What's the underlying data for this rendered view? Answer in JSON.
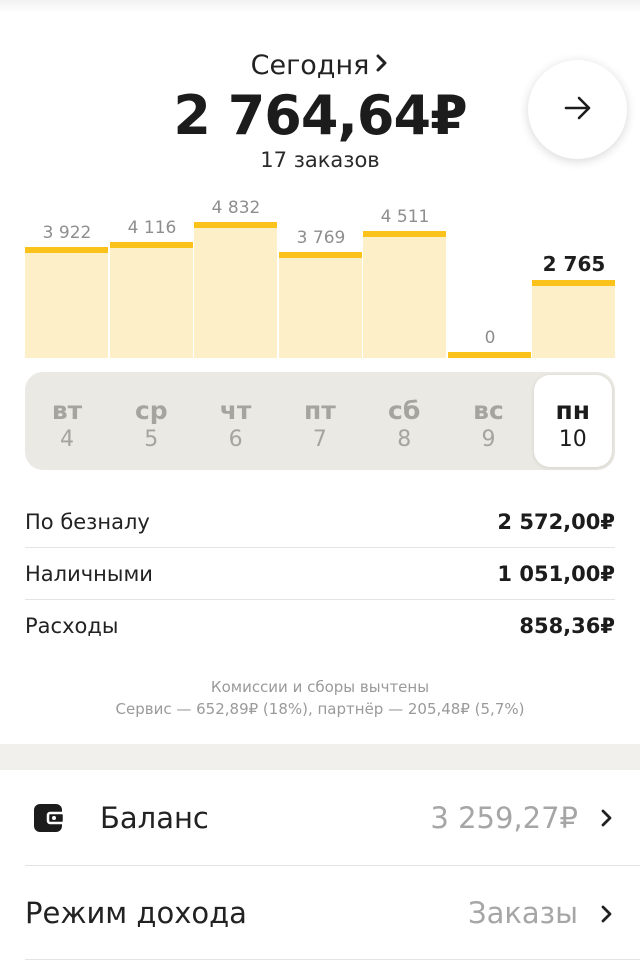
{
  "summary": {
    "period_label": "Сегодня",
    "total": "2 764,64₽",
    "orders": "17 заказов"
  },
  "chart_data": {
    "type": "bar",
    "categories": [
      "вт 4",
      "ср 5",
      "чт 6",
      "пт 7",
      "сб 8",
      "вс 9",
      "пн 10"
    ],
    "values": [
      3922,
      4116,
      4832,
      3769,
      4511,
      0,
      2765
    ],
    "value_labels": [
      "3 922",
      "4 116",
      "4 832",
      "3 769",
      "4 511",
      "0",
      "2 765"
    ],
    "active_index": 6,
    "ylim": [
      0,
      5600
    ],
    "colors": {
      "bar_fill": "#fdf0c9",
      "bar_top": "#fac21b"
    }
  },
  "days": [
    {
      "dow": "вт",
      "num": "4"
    },
    {
      "dow": "ср",
      "num": "5"
    },
    {
      "dow": "чт",
      "num": "6"
    },
    {
      "dow": "пт",
      "num": "7"
    },
    {
      "dow": "сб",
      "num": "8"
    },
    {
      "dow": "вс",
      "num": "9"
    },
    {
      "dow": "пн",
      "num": "10"
    }
  ],
  "breakdown": [
    {
      "label": "По безналу",
      "value": "2 572,00₽"
    },
    {
      "label": "Наличными",
      "value": "1 051,00₽"
    },
    {
      "label": "Расходы",
      "value": "858,36₽"
    }
  ],
  "note": {
    "line1": "Комиссии и сборы вычтены",
    "line2": "Сервис — 652,89₽ (18%), партнёр — 205,48₽ (5,7%)"
  },
  "menu": {
    "balance": {
      "icon": "wallet-icon",
      "title": "Баланс",
      "value": "3 259,27₽"
    },
    "income_mode": {
      "title": "Режим дохода",
      "value": "Заказы"
    }
  },
  "icons": {
    "next": "arrow-right-icon",
    "chevron": "chevron-right-icon"
  }
}
